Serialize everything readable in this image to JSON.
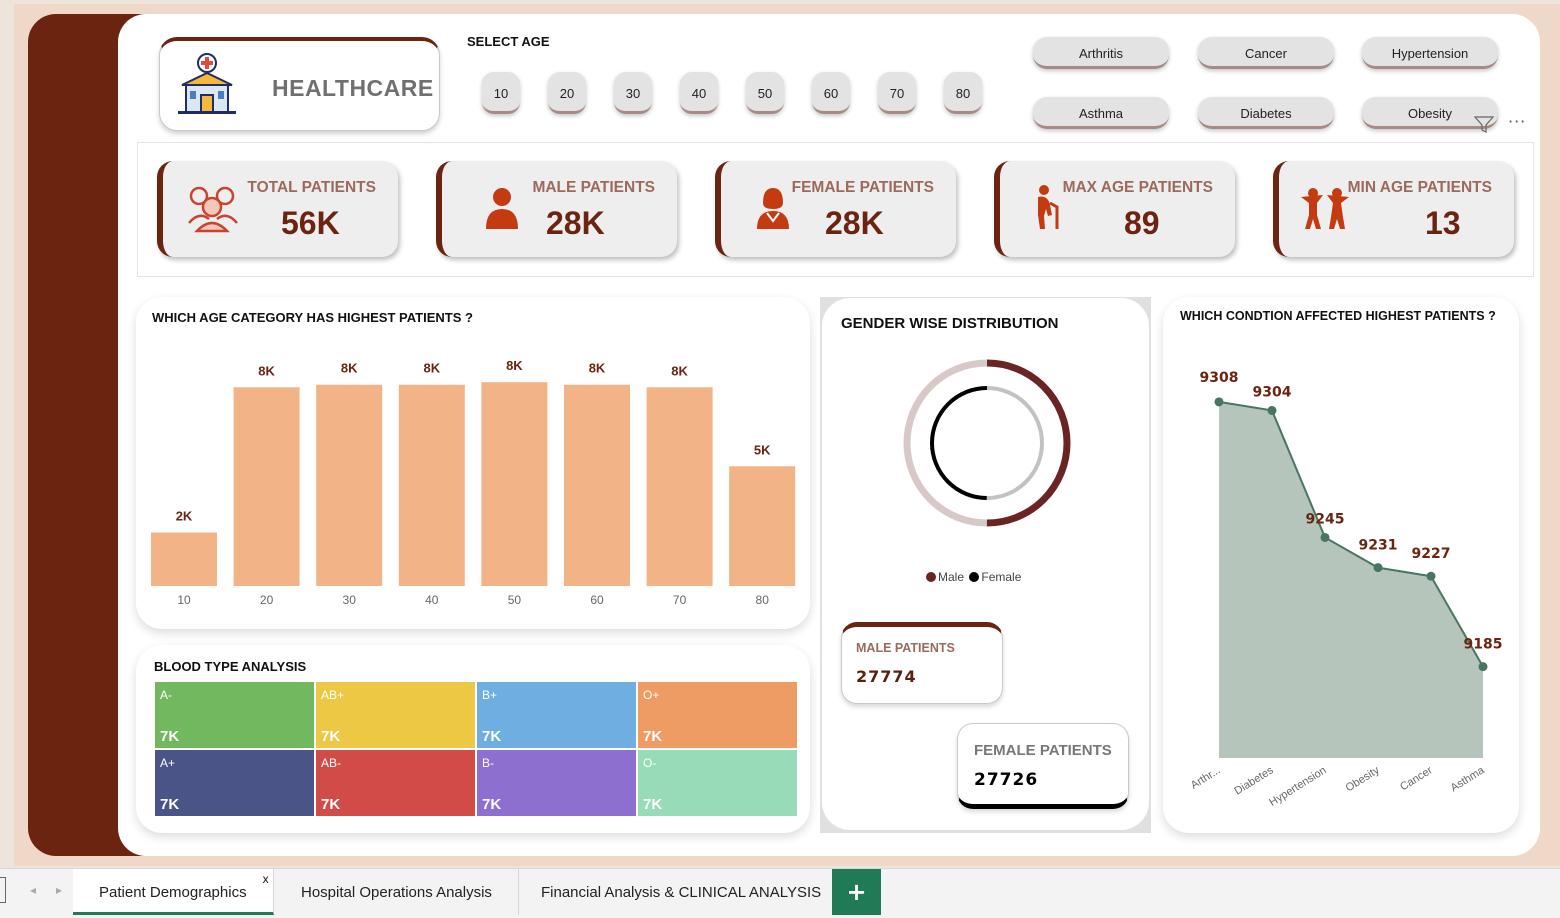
{
  "header": {
    "logo_title": "HEALTHCARE",
    "age_label": "SELECT AGE",
    "age_options": [
      "10",
      "20",
      "30",
      "40",
      "50",
      "60",
      "70",
      "80"
    ],
    "condition_options": [
      "Arthritis",
      "Cancer",
      "Hypertension",
      "Asthma",
      "Diabetes",
      "Obesity"
    ]
  },
  "kpis": [
    {
      "label": "TOTAL PATIENTS",
      "value": "56K",
      "icon": "group-icon"
    },
    {
      "label": "MALE PATIENTS",
      "value": "28K",
      "icon": "male-icon"
    },
    {
      "label": "FEMALE PATIENTS",
      "value": "28K",
      "icon": "female-icon"
    },
    {
      "label": "MAX AGE PATIENTS",
      "value": "89",
      "icon": "elderly-icon"
    },
    {
      "label": "MIN AGE PATIENTS",
      "value": "13",
      "icon": "children-icon"
    }
  ],
  "age_chart": {
    "title": "WHICH AGE CATEGORY HAS HIGHEST PATIENTS ?",
    "chart_data": {
      "type": "bar",
      "categories": [
        "10",
        "20",
        "30",
        "40",
        "50",
        "60",
        "70",
        "80"
      ],
      "values": [
        2.1,
        7.8,
        7.9,
        7.9,
        8.0,
        7.9,
        7.8,
        4.7
      ],
      "data_labels": [
        "2K",
        "8K",
        "8K",
        "8K",
        "8K",
        "8K",
        "8K",
        "5K"
      ],
      "ylim": [
        0,
        8.4
      ]
    }
  },
  "blood": {
    "title": "BLOOD TYPE ANALYSIS",
    "cells": [
      {
        "type": "A-",
        "value": "7K",
        "color": "#72b85f"
      },
      {
        "type": "AB+",
        "value": "7K",
        "color": "#ecc845"
      },
      {
        "type": "B+",
        "value": "7K",
        "color": "#6eaee0"
      },
      {
        "type": "O+",
        "value": "7K",
        "color": "#ee9c64"
      },
      {
        "type": "A+",
        "value": "7K",
        "color": "#4a5487"
      },
      {
        "type": "AB-",
        "value": "7K",
        "color": "#d14c48"
      },
      {
        "type": "B-",
        "value": "7K",
        "color": "#8d6fcf"
      },
      {
        "type": "O-",
        "value": "7K",
        "color": "#98dbb9"
      }
    ]
  },
  "gender": {
    "title": "GENDER WISE DISTRIBUTION",
    "legend_male": "Male",
    "legend_female": "Female",
    "male_color": "#6b2424",
    "female_color": "#000000",
    "male_card_label": "MALE PATIENTS",
    "male_card_value": "27774",
    "female_card_label": "FEMALE PATIENTS",
    "female_card_value": "27726",
    "chart_data": {
      "type": "pie",
      "categories": [
        "Male",
        "Female"
      ],
      "values": [
        27774,
        27726
      ]
    }
  },
  "condition_chart": {
    "title": "WHICH CONDTION AFFECTED HIGHEST PATIENTS ?",
    "chart_data": {
      "type": "area",
      "categories": [
        "Arthr...",
        "Diabetes",
        "Hypertension",
        "Obesity",
        "Cancer",
        "Asthma"
      ],
      "values": [
        9308,
        9304,
        9245,
        9231,
        9227,
        9185
      ],
      "ylim": [
        9150,
        9320
      ]
    }
  },
  "tabs": {
    "items": [
      "Patient Demographics",
      "Hospital Operations Analysis",
      "Financial Analysis & CLINICAL ANALYSIS"
    ],
    "close": "x",
    "add": "+"
  }
}
